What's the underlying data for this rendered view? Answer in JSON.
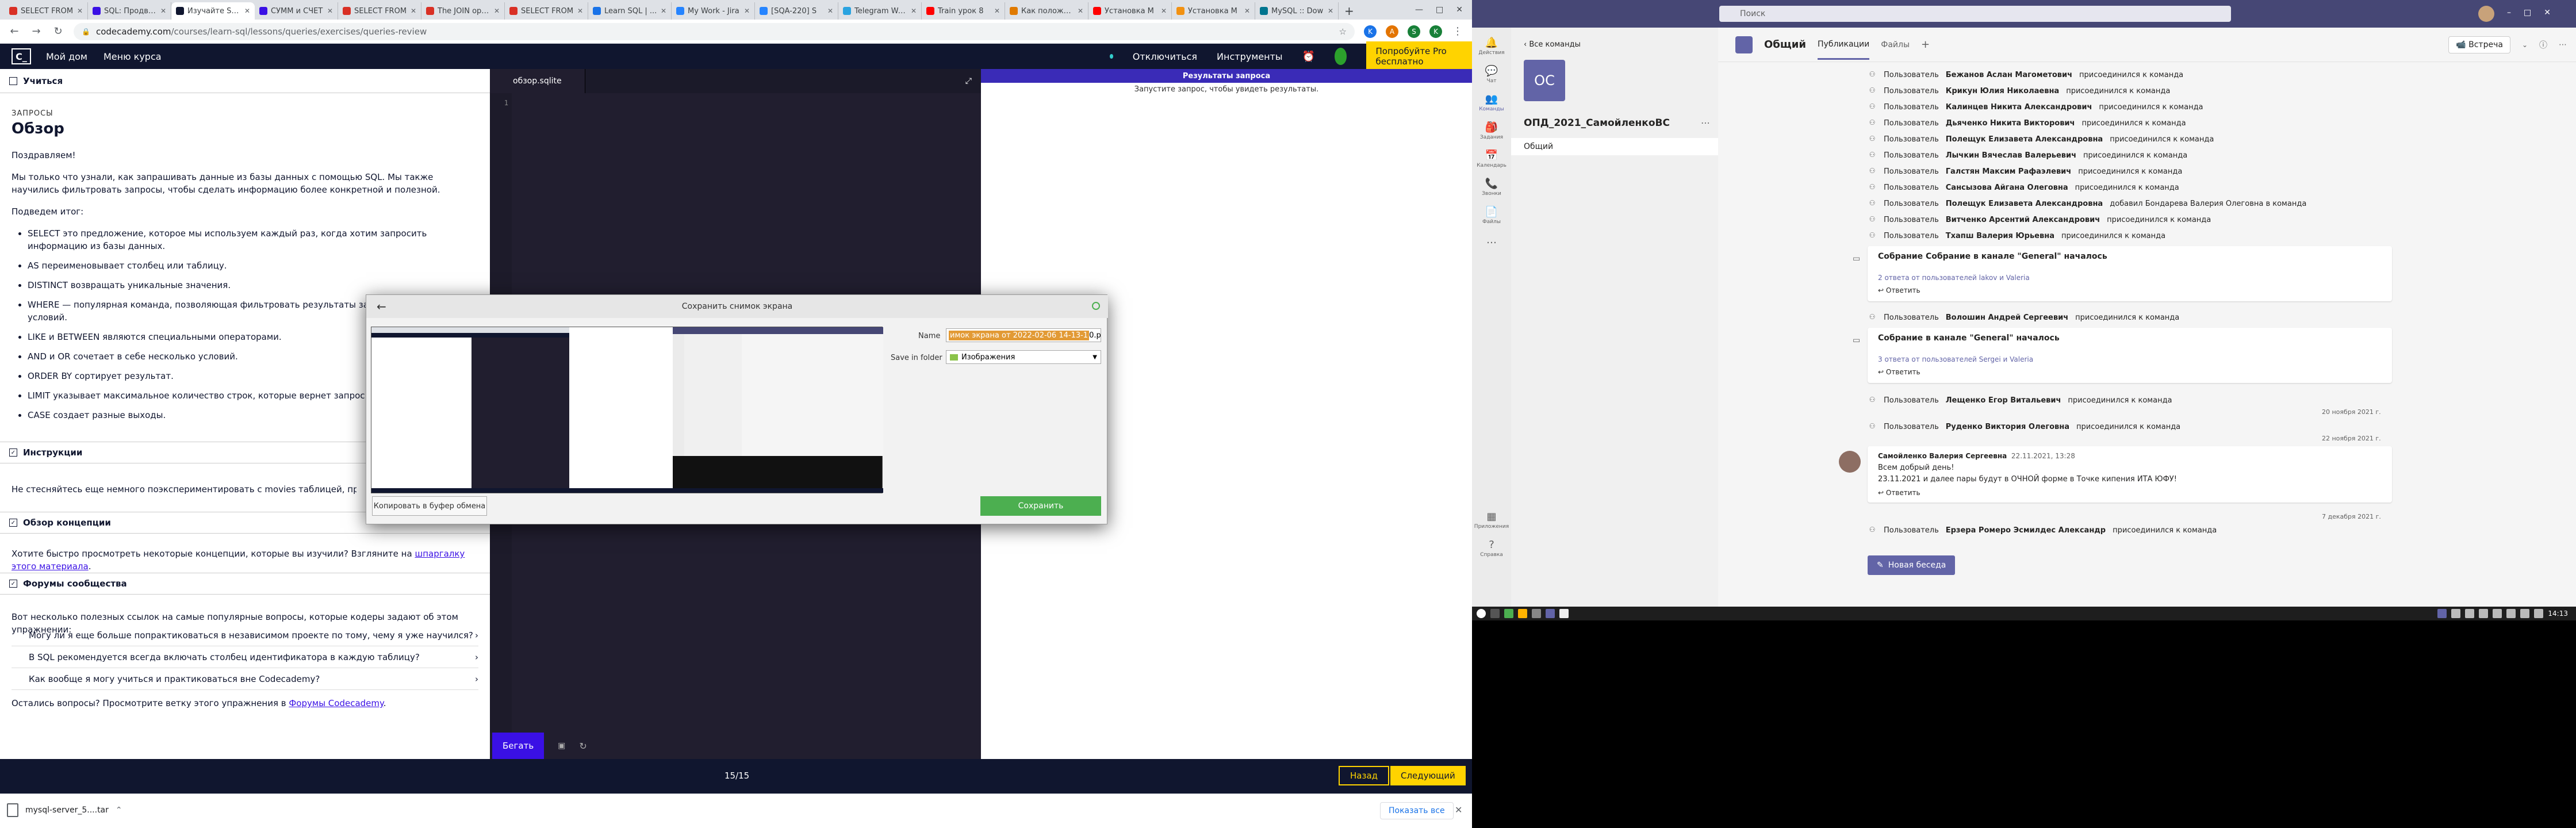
{
  "browser": {
    "tabs": [
      {
        "label": "SELECT FROM",
        "color": "#d93025"
      },
      {
        "label": "SQL: Продвинутый",
        "color": "#3a10e5"
      },
      {
        "label": "Изучайте SQL",
        "color": "#10162f",
        "active": true
      },
      {
        "label": "СУММ и СЧЁТ",
        "color": "#3a10e5"
      },
      {
        "label": "SELECT FROM",
        "color": "#d93025"
      },
      {
        "label": "The JOIN operation",
        "color": "#d93025"
      },
      {
        "label": "SELECT FROM",
        "color": "#d93025"
      },
      {
        "label": "Learn SQL | ...",
        "color": "#1a73e8"
      },
      {
        "label": "My Work - Jira",
        "color": "#2684ff"
      },
      {
        "label": "[SQA-220] S",
        "color": "#2684ff"
      },
      {
        "label": "Telegram Web",
        "color": "#2aa3e0"
      },
      {
        "label": "Train урок 8",
        "color": "#ff0000"
      },
      {
        "label": "Как положить",
        "color": "#e07a00"
      },
      {
        "label": "Установка M",
        "color": "#ff0000"
      },
      {
        "label": "Установка M",
        "color": "#f29111"
      },
      {
        "label": "MySQL :: Dow",
        "color": "#00758f"
      }
    ],
    "new_tab": "+",
    "window_controls": [
      "—",
      "□",
      "✕"
    ],
    "url_host": "codecademy.com",
    "url_path": "/courses/learn-sql/lessons/queries/exercises/queries-review",
    "nav": {
      "back": "←",
      "forward": "→",
      "reload": "↻"
    },
    "ext_letters": [
      "K",
      "A",
      "S"
    ],
    "profile": "K"
  },
  "codecademy": {
    "logo": "C_",
    "nav_items": [
      "Мой дом",
      "Меню курса"
    ],
    "right_items": [
      "Отключиться",
      "Инструменты"
    ],
    "try_pro": "Попробуйте Pro бесплатно",
    "learn_tab": "Учиться",
    "kicker": "ЗАПРОСЫ",
    "title": "Обзор",
    "p1": "Поздравляем!",
    "p2": "Мы только что узнали, как запрашивать данные из базы данных с помощью SQL. Мы также научились фильтровать запросы, чтобы сделать информацию более конкретной и полезной.",
    "p3": "Подведем итог:",
    "bullets": [
      "SELECT это предложение, которое мы используем каждый раз, когда хотим запросить информацию из базы данных.",
      "AS переименовывает столбец или таблицу.",
      "DISTINCT возвращать уникальные значения.",
      "WHERE — популярная команда, позволяющая фильтровать результаты запроса на основе условий.",
      "LIKE и BETWEEN являются специальными операторами.",
      "AND и OR сочетает в себе несколько условий.",
      "ORDER BY сортирует результат.",
      "LIMIT указывает максимальное количество строк, которые вернет запрос.",
      "CASE создает разные выходы."
    ],
    "instructions_h": "Инструкции",
    "instructions_p": "Не стесняйтесь еще немного поэкспериментировать с movies таблицей, прежде чем",
    "concepts_h": "Обзор концепции",
    "concepts_p1": "Хотите быстро просмотреть некоторые концепции, которые вы изучили? Взгляните на",
    "concepts_link": "шпаргалку этого материала",
    "concepts_end": ".",
    "forums_h": "Форумы сообщества",
    "forums_p": "Вот несколько полезных ссылок на самые популярные вопросы, которые кодеры задают об этом упражнении:",
    "forum_items": [
      "Могу ли я еще больше попрактиковаться в независимом проекте по тому, чему я уже научился?",
      "В SQL рекомендуется всегда включать столбец идентификатора в каждую таблицу?",
      "Как вообще я могу учиться и практиковаться вне Codecademy?"
    ],
    "forums_tail_a": "Остались вопросы? Просмотрите ветку этого упражнения в",
    "forums_tail_link": "Форумы Codecademy",
    "forums_tail_end": ".",
    "editor_tab": "обзор.sqlite",
    "gutter_line": "1",
    "run": "Бегать",
    "results_head": "Результаты запроса",
    "results_msg": "Запустите запрос, чтобы увидеть результаты.",
    "pager": "15/15",
    "back": "Назад",
    "next": "Следующий"
  },
  "downloads": {
    "file": "mysql-server_5....tar",
    "show_all": "Показать все",
    "close": "✕"
  },
  "dialog": {
    "title": "Сохранить снимок экрана",
    "name_label": "Name",
    "name_value_sel": "имок экрана от 2022-02-06 14-13-1",
    "name_value_ext": "0.png",
    "folder_label": "Save in folder",
    "folder_value": "Изображения",
    "copy": "Копировать в буфер обмена",
    "save": "Сохранить"
  },
  "teams": {
    "search": "Поиск",
    "rail": [
      "Действия",
      "Чат",
      "Команды",
      "Задания",
      "Календарь",
      "Звонки",
      "Файлы",
      "…",
      "Приложения",
      "Справка"
    ],
    "all_teams": "Все команды",
    "team_initials": "ОС",
    "team_name": "ОПД_2021_СамойленкоВС",
    "channel": "Общий",
    "header_title": "Общий",
    "header_tabs": [
      "Публикации",
      "Файлы"
    ],
    "meet": "Встреча",
    "events1": [
      {
        "who": "Пользователь",
        "name": "Бежанов Аслан Магометович",
        "act": "присоединился к команда"
      },
      {
        "who": "Пользователь",
        "name": "Крикун Юлия Николаевна",
        "act": "присоединился к команда"
      },
      {
        "who": "Пользователь",
        "name": "Калинцев Никита Александрович",
        "act": "присоединился к команда"
      },
      {
        "who": "Пользователь",
        "name": "Дьяченко Никита Викторович",
        "act": "присоединился к команда"
      },
      {
        "who": "Пользователь",
        "name": "Полещук Елизавета Александровна",
        "act": "присоединился к команда"
      },
      {
        "who": "Пользователь",
        "name": "Лычкин Вячеслав Валерьевич",
        "act": "присоединился к команда"
      },
      {
        "who": "Пользователь",
        "name": "Галстян Максим Рафаэлевич",
        "act": "присоединился к команда"
      },
      {
        "who": "Пользователь",
        "name": "Сансызова Айгана Олеговна",
        "act": "присоединился к команда"
      },
      {
        "who": "Пользователь",
        "name": "Полещук Елизавета Александровна",
        "act": "добавил Бондарева Валерия Олеговна в команда"
      },
      {
        "who": "Пользователь",
        "name": "Витченко Арсентий Александрович",
        "act": "присоединился к команда"
      },
      {
        "who": "Пользователь",
        "name": "Тхапш Валерия Юрьевна",
        "act": "присоединился к команда"
      }
    ],
    "meeting_title": "Собрание Собрание в канале \"General\" началось",
    "meeting1_replies": "2 ответа от пользователей lakov и Valeria",
    "reply": "Ответить",
    "event_mid": {
      "who": "Пользователь",
      "name": "Волошин Андрей Сергеевич",
      "act": "присоединился к команда"
    },
    "meeting2_title": "Собрание в канале \"General\" началось",
    "meeting2_replies": "3 ответа от пользователей Sergei и Valeria",
    "event_a": {
      "who": "Пользователь",
      "name": "Лещенко Егор Витальевич",
      "act": "присоединился к команда"
    },
    "date1": "20 ноября 2021 г.",
    "event_b": {
      "who": "Пользователь",
      "name": "Руденко Виктория Олеговна",
      "act": "присоединился к команда"
    },
    "date2": "22 ноября 2021 г.",
    "post_author": "Самойленко Валерия Сергеевна",
    "post_time": "22.11.2021, 13:28",
    "post_line1": "Всем добрый день!",
    "post_line2": "23.11.2021 и далее пары будут в ОЧНОЙ форме в Точке кипения ИТА ЮФУ!",
    "date3": "7 декабря 2021 г.",
    "event_c": {
      "who": "Пользователь",
      "name": "Ерзера Ромеро Эсмилдес Александр",
      "act": "присоединился к команда"
    },
    "new_convo": "Новая беседа"
  },
  "taskbar": {
    "time": "14:13"
  }
}
